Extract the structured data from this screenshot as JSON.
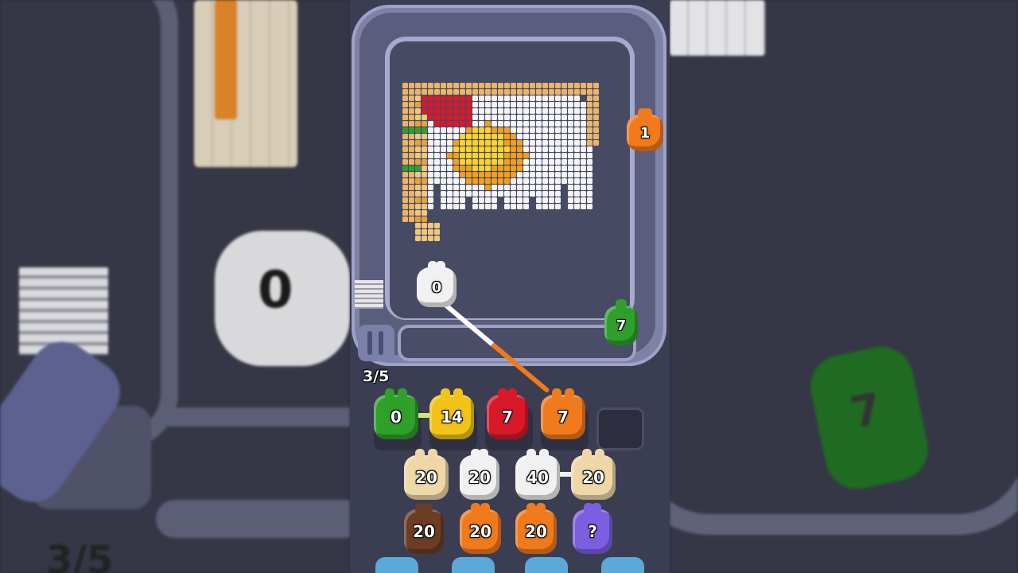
{
  "game": {
    "progress_label": "3/5",
    "background_progress_label": "3/5",
    "colors": {
      "green": "#2fa02a",
      "yellow": "#f2c417",
      "red": "#d7192a",
      "orange": "#f07a1c",
      "white": "#f1f1f1",
      "cream": "#efd7a8",
      "brown": "#6b3d24",
      "purple": "#7b5fe0",
      "track": "#7e82a6"
    },
    "board_pieces": [
      {
        "color": "orange",
        "count": "1"
      },
      {
        "color": "white",
        "count": "0"
      },
      {
        "color": "green",
        "count": "7"
      }
    ],
    "queue": [
      {
        "color": "green",
        "count": "0"
      },
      {
        "color": "yellow",
        "count": "14"
      },
      {
        "color": "red",
        "count": "7"
      },
      {
        "color": "orange",
        "count": "7"
      },
      {
        "color": "empty",
        "count": ""
      }
    ],
    "reserve_row1": [
      {
        "color": "cream",
        "count": "20"
      },
      {
        "color": "white",
        "count": "20"
      },
      {
        "color": "white",
        "count": "40"
      },
      {
        "color": "cream",
        "count": "20"
      }
    ],
    "reserve_row2": [
      {
        "color": "brown",
        "count": "20"
      },
      {
        "color": "orange",
        "count": "20"
      },
      {
        "color": "orange",
        "count": "20"
      },
      {
        "color": "purple",
        "count": "?"
      }
    ],
    "background_pieces": [
      {
        "color": "white",
        "count": "0"
      },
      {
        "color": "green",
        "count": "7"
      }
    ]
  }
}
